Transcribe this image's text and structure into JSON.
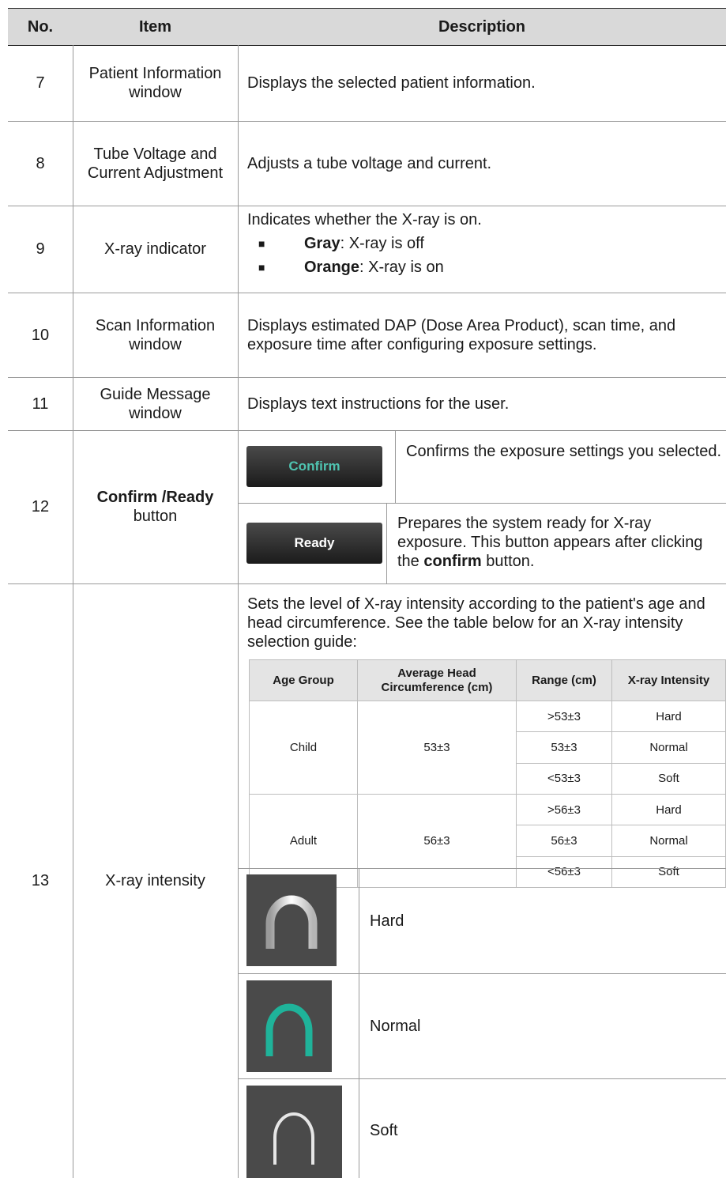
{
  "header": {
    "no": "No.",
    "item": "Item",
    "description": "Description"
  },
  "rows": [
    {
      "no": "7",
      "item": "Patient Information window",
      "description": "Displays the selected patient information."
    },
    {
      "no": "8",
      "item": "Tube Voltage and Current Adjustment",
      "description": "Adjusts a tube voltage and current."
    },
    {
      "no": "9",
      "item": "X-ray indicator",
      "description": "Indicates whether the X-ray is on.",
      "bullets": [
        {
          "bold": "Gray",
          "rest": ": X-ray is off"
        },
        {
          "bold": "Orange",
          "rest": ": X-ray is on"
        }
      ]
    },
    {
      "no": "10",
      "item": "Scan Information window",
      "description": "Displays estimated DAP (Dose Area Product), scan time, and exposure time after configuring exposure settings."
    },
    {
      "no": "11",
      "item": "Guide Message window",
      "description": "Displays text instructions for the user."
    },
    {
      "no": "12",
      "item_bold": "Confirm /Ready",
      "item_rest": " button",
      "confirm_button": "Confirm",
      "confirm_desc": "Confirms the exposure settings you selected.",
      "ready_button": "Ready",
      "ready_desc_1": "Prepares the system ready for X-ray exposure. This button appears after clicking the ",
      "ready_desc_bold": "confirm",
      "ready_desc_2": " button.",
      "button_text_colors": {
        "confirm": "#4fc3b0",
        "ready": "#ffffff"
      }
    },
    {
      "no": "13",
      "item": "X-ray intensity",
      "description": "Sets the level of X-ray intensity according to the patient's age and head circumference. See the table below for an X-ray intensity selection guide:",
      "guide_table": {
        "headers": [
          "Age Group",
          "Average Head Circumference (cm)",
          "Range (cm)",
          "X-ray Intensity"
        ],
        "groups": [
          {
            "age": "Child",
            "avg": "53±3",
            "ranges": [
              ">53±3",
              "53±3",
              "<53±3"
            ],
            "intensities": [
              "Hard",
              "Normal",
              "Soft"
            ]
          },
          {
            "age": "Adult",
            "avg": "56±3",
            "ranges": [
              ">56±3",
              "56±3",
              "<56±3"
            ],
            "intensities": [
              "Hard",
              "Normal",
              "Soft"
            ]
          }
        ]
      },
      "modes": [
        {
          "label": "Hard",
          "icon": "hard-arch-icon",
          "color": "#e6e6e6"
        },
        {
          "label": "Normal",
          "icon": "normal-arch-icon",
          "color": "#1fb39a"
        },
        {
          "label": "Soft",
          "icon": "soft-arch-icon",
          "color": "#e6e6e6"
        }
      ]
    }
  ]
}
